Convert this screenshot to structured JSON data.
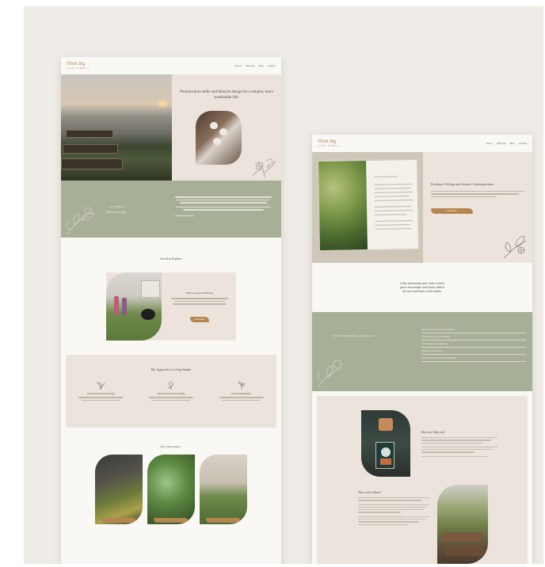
{
  "brand": {
    "logo_line1": "Think Big",
    "logo_line2": "LIVE SIMPLY"
  },
  "nav_a": [
    "About",
    "Offerings",
    "Blog",
    "Contact"
  ],
  "nav_b": [
    "About",
    "Offerings",
    "Blog",
    "Contact"
  ],
  "mock_a": {
    "hero_title": "Permaculture skills and lifestyle design for a simpler, more sustainable life.",
    "band_kicker": "Live Simply",
    "band_value": "Choose enough",
    "scroll_title": "Scroll to Explore",
    "scroll_card_title": "Mini Courses and Books",
    "scroll_card_button": "Learn More",
    "approach_title": "My Approach to Living Simply",
    "approach_cols": [
      "Permaculture Lifestyle Design",
      "Values-based Decision Making",
      "Radical Homemaking"
    ],
    "dig_title": "Dig a little deeper...",
    "arch_buttons": [
      "Read More",
      "Read More",
      "Read More"
    ]
  },
  "mock_b": {
    "hero_title": "Freelance Writing and Science Communication",
    "hero_button": "Learn More",
    "simple_lines": [
      "I take information and create written",
      "pieces that simple and clearly land in",
      "the eyes and hearts of the reader."
    ],
    "band_kicker": "Some of the industries I specialise in:",
    "band_rows": [
      "Agriculture and regenerative farming",
      "Permaculture and sustainability",
      "Natural health and wellbeing",
      "Education and learning",
      "Small business and creative enterprise"
    ],
    "help_title": "How can I help you?",
    "why_title": "Why work with me?"
  }
}
